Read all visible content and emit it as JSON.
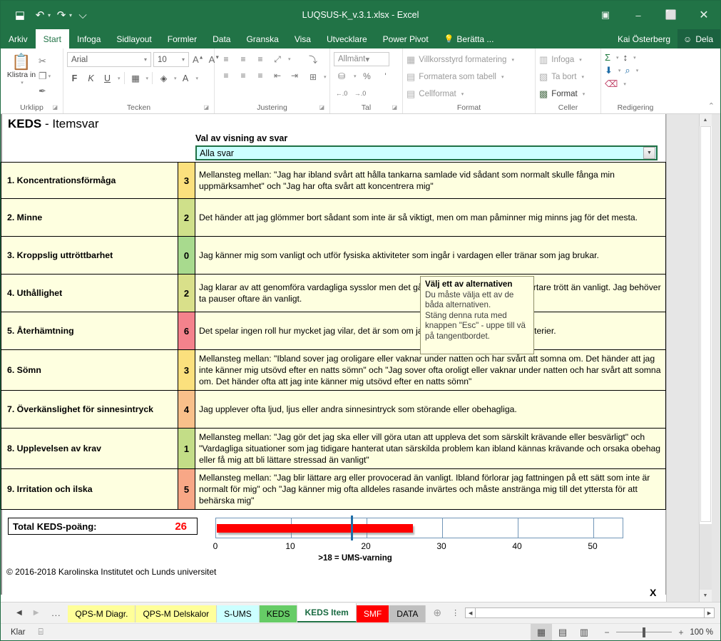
{
  "window": {
    "title": "LUQSUS-K_v.3.1.xlsx - Excel",
    "qat": [
      {
        "name": "save-icon",
        "glyph": "⬓"
      },
      {
        "name": "undo-icon",
        "glyph": "↶"
      },
      {
        "name": "redo-icon",
        "glyph": "↷"
      },
      {
        "name": "customize-qat-icon",
        "glyph": "⌵"
      }
    ],
    "controls": [
      {
        "name": "ribbon-display-options",
        "glyph": "▣"
      },
      {
        "name": "minimize",
        "glyph": "–"
      },
      {
        "name": "restore",
        "glyph": "⬜"
      },
      {
        "name": "close",
        "glyph": "✕"
      }
    ]
  },
  "ribbon": {
    "tabs": [
      {
        "label": "Arkiv",
        "active": false
      },
      {
        "label": "Start",
        "active": true
      },
      {
        "label": "Infoga",
        "active": false
      },
      {
        "label": "Sidlayout",
        "active": false
      },
      {
        "label": "Formler",
        "active": false
      },
      {
        "label": "Data",
        "active": false
      },
      {
        "label": "Granska",
        "active": false
      },
      {
        "label": "Visa",
        "active": false
      },
      {
        "label": "Utvecklare",
        "active": false
      },
      {
        "label": "Power Pivot",
        "active": false
      }
    ],
    "tell_me": "Berätta ...",
    "user": "Kai Österberg",
    "share": "Dela",
    "groups": {
      "clipboard": {
        "title": "Urklipp",
        "paste": "Klistra in",
        "cut_icon": "✂",
        "copy_icon": "❐",
        "format_painter_icon": "✒"
      },
      "font": {
        "title": "Tecken",
        "font_name": "Arial",
        "font_size": "10",
        "grow": "A",
        "shrink": "A",
        "bold": "F",
        "italic": "K",
        "underline": "U",
        "borders_icon": "▦",
        "fill_icon": "◈",
        "color_icon": "A"
      },
      "alignment": {
        "title": "Justering",
        "top": "≡",
        "middle": "≡",
        "bottom": "≡",
        "orientation": "⤢",
        "left": "≡",
        "center": "≡",
        "right": "≡",
        "decrease_indent": "⇤",
        "increase_indent": "⇥",
        "wrap_text": "⤵",
        "merge": "⊞"
      },
      "number": {
        "title": "Tal",
        "format": "Allmänt",
        "currency_icon": "⛁",
        "percent": "%",
        "thousands": "'",
        "inc_dec": "←.0",
        "dec_dec": "→.0"
      },
      "styles": {
        "title": "Format",
        "conditional": "Villkorsstyrd formatering",
        "as_table": "Formatera som tabell",
        "cell_styles": "Cellformat"
      },
      "cells": {
        "title": "Celler",
        "insert": "Infoga",
        "delete": "Ta bort",
        "format": "Format"
      },
      "editing": {
        "title": "Redigering",
        "autosum": "Σ",
        "sort": "↕",
        "fill": "⬇",
        "find": "⌕",
        "clear": "⌫"
      }
    }
  },
  "sheet": {
    "heading_bold": "KEDS",
    "heading_rest": " - Itemsvar",
    "select_label": "Val av visning av svar",
    "select_value": "Alla svar",
    "x_mark": "X",
    "copyright": "© 2016-2018 Karolinska Institutet och Lunds universitet",
    "total_label": "Total KEDS-poäng:",
    "total_value": "26",
    "rows": [
      {
        "label": "1. Koncentrationsförmåga",
        "score": "3",
        "color": "#fbe07d",
        "text": "Mellansteg mellan: \"Jag har ibland svårt att hålla tankarna samlade vid sådant som normalt skulle fånga min uppmärksamhet\" och \"Jag har ofta svårt att koncentrera mig\""
      },
      {
        "label": "2. Minne",
        "score": "2",
        "color": "#cfe08a",
        "text": "Det händer att jag glömmer bort sådant som inte är så viktigt, men om man påminner mig minns jag för det mesta."
      },
      {
        "label": "3. Kroppslig uttröttbarhet",
        "score": "0",
        "color": "#a8da8e",
        "text": "Jag känner mig som vanligt och utför fysiska aktiviteter som ingår i vardagen eller tränar som jag brukar."
      },
      {
        "label": "4. Uthållighet",
        "score": "2",
        "color": "#d9e08a",
        "text": "Jag klarar av att genomföra vardagliga sysslor men det går åt mer energi och jag blir fortare trött än vanligt. Jag behöver ta pauser oftare än vanligt."
      },
      {
        "label": "5. Återhämtning",
        "score": "6",
        "color": "#f4828c",
        "text": "Det spelar ingen roll hur mycket jag vilar, det är som om jag inte kan ladda om mina batterier."
      },
      {
        "label": "6. Sömn",
        "score": "3",
        "color": "#fbe07d",
        "text": "Mellansteg mellan: \"Ibland sover jag oroligare eller vaknar under natten och har svårt att somna om. Det händer att jag inte känner mig utsövd efter en natts sömn\" och \"Jag sover ofta oroligt eller vaknar under natten och har svårt att somna om. Det händer ofta att jag inte känner mig utsövd efter en natts sömn\""
      },
      {
        "label": "7. Överkänslighet för sinnesintryck",
        "score": "4",
        "color": "#f9c08a",
        "text": "Jag upplever ofta ljud, ljus eller andra sinnesintryck som störande eller obehagliga."
      },
      {
        "label": "8. Upplevelsen av krav",
        "score": "1",
        "color": "#c3dd87",
        "text": "Mellansteg mellan: \"Jag gör det jag ska eller vill göra utan att uppleva det som särskilt krävande eller besvärligt\" och \"Vardagliga situationer som jag tidigare hanterat utan särskilda problem kan ibland kännas krävande och orsaka obehag eller få mig att bli lättare stressad än vanligt\""
      },
      {
        "label": "9. Irritation och ilska",
        "score": "5",
        "color": "#f8a786",
        "text": "Mellansteg mellan: \"Jag blir lättare arg eller provocerad än vanligt. Ibland förlorar jag fattningen på ett sätt som inte är normalt för mig\" och \"Jag känner mig ofta alldeles rasande invärtes och måste anstränga mig till det yttersta för att behärska mig\""
      }
    ]
  },
  "tooltip": {
    "title": "Välj ett av alternativen",
    "body": "Du måste välja ett av de båda alternativen.\nStäng denna ruta med knappen \"Esc\" - uppe till vä på tangentbordet."
  },
  "chart_data": {
    "type": "bar",
    "title": "",
    "orientation": "horizontal",
    "categories": [
      "Total KEDS-poäng"
    ],
    "values": [
      26
    ],
    "xlabel": "",
    "ylabel": "",
    "xlim": [
      0,
      54
    ],
    "ticks": [
      0,
      10,
      20,
      30,
      40,
      50
    ],
    "tick_labels": [
      "0",
      "10",
      "20",
      "30",
      "40",
      "50"
    ],
    "gridlines": [
      10,
      20,
      30,
      40,
      50
    ],
    "bar_color": "#ff0000",
    "marker": {
      "value": 18,
      "color": "#1f6ea8",
      "label": ">18 = UMS-varning"
    },
    "legend": "none",
    "grid": true
  },
  "tabbar": {
    "nav_prev": "◀",
    "nav_next": "▶",
    "nav_dots": "...",
    "tabs": [
      {
        "label": "QPS-M Diagr.",
        "color": "#ffff99",
        "active": false
      },
      {
        "label": "QPS-M Delskalor",
        "color": "#ffff99",
        "active": false
      },
      {
        "label": "S-UMS",
        "color": "#ccffff",
        "active": false
      },
      {
        "label": "KEDS",
        "color": "#66cc66",
        "active": false
      },
      {
        "label": "KEDS Item",
        "color": "#ffffff",
        "active": true
      },
      {
        "label": "SMF",
        "color": "#ff0000",
        "active": false
      },
      {
        "label": "DATA",
        "color": "#bfbfbf",
        "active": false
      }
    ],
    "add_sheet": "⊕",
    "kebab": "⋮"
  },
  "statusbar": {
    "ready": "Klar",
    "macro_icon": "⌸",
    "views": [
      {
        "name": "normal-view",
        "glyph": "▦",
        "selected": true
      },
      {
        "name": "page-layout-view",
        "glyph": "▤",
        "selected": false
      },
      {
        "name": "page-break-view",
        "glyph": "▥",
        "selected": false
      }
    ],
    "zoom_out": "−",
    "zoom_in": "+",
    "zoom_level": "100 %"
  }
}
